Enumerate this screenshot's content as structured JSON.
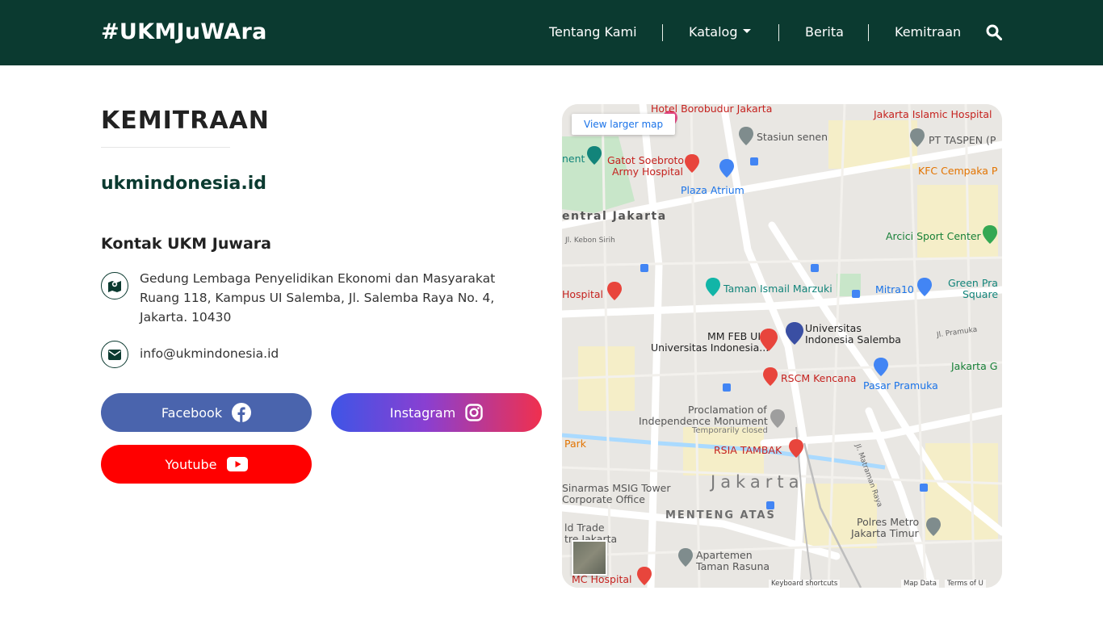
{
  "header": {
    "brand": "#UKMJuWAra",
    "nav": [
      {
        "label": "Tentang Kami",
        "icon": null
      },
      {
        "label": "Katalog",
        "icon": "caret-down-icon"
      },
      {
        "label": "Berita",
        "icon": null
      },
      {
        "label": "Kemitraan",
        "icon": null
      }
    ],
    "search_icon": "search-icon"
  },
  "main": {
    "title": "KEMITRAAN",
    "site": "ukmindonesia.id",
    "contact_heading": "Kontak UKM Juwara",
    "address_lines": [
      "Gedung Lembaga Penyelidikan Ekonomi dan Masyarakat",
      "Ruang 118, Kampus UI Salemba, Jl. Salemba Raya No. 4,",
      "Jakarta. 10430"
    ],
    "email": "info@ukmindonesia.id",
    "buttons": {
      "facebook": "Facebook",
      "instagram": "Instagram",
      "youtube": "Youtube"
    }
  },
  "map": {
    "larger_map": "View larger map",
    "labels": {
      "hotel": "Hotel Borobudur Jakarta",
      "islamic_hospital": "Jakarta Islamic Hospital",
      "stasiun": "Stasiun senen",
      "taspen": "PT TASPEN (P",
      "nent": "nent",
      "gatot1": "Gatot Soebroto",
      "gatot2": "Army Hospital",
      "kfc": "KFC Cempaka P",
      "plaza": "Plaza Atrium",
      "central": "entral Jakarta",
      "kebon": "Jl. Kebon Sirih",
      "arcici": "Arcici Sport Center",
      "hospital": "Hospital",
      "tim": "Taman Ismail Marzuki",
      "mitra": "Mitra10",
      "green1": "Green Pra",
      "green2": "Square",
      "pramuka_road": "Jl. Pramuka",
      "mmfeb1": "MM FEB UI",
      "mmfeb2": "Universitas Indonesia...",
      "uis1": "Universitas",
      "uis2": "Indonesia Salemba",
      "rscm": "RSCM Kencana",
      "jakarta_g": "Jakarta G",
      "pasar": "Pasar Pramuka",
      "proc1": "Proclamation of",
      "proc2": "Independence Monument",
      "proc3": "Temporarily closed",
      "matraman": "Jl. Matraman Raya",
      "park": "Park",
      "rsia": "RSIA TAMBAK",
      "jakarta": "Jakarta",
      "sinarmas1": "Sinarmas MSIG Tower",
      "sinarmas2": "Corporate Office",
      "menteng": "MENTENG ATAS",
      "ld1": "ld Trade",
      "ld2": "tre Jakarta",
      "polres1": "Polres Metro",
      "polres2": "Jakarta Timur",
      "apartemen1": "Apartemen",
      "apartemen2": "Taman Rasuna",
      "mmc": "MC Hospital",
      "keyboard": "Keyboard shortcuts",
      "mapdata": "Map Data",
      "terms": "Terms of U"
    }
  }
}
